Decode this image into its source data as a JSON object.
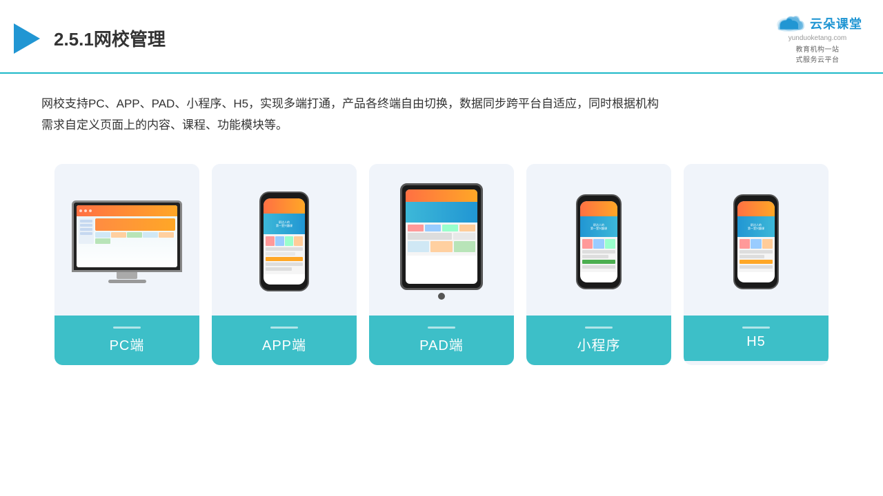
{
  "header": {
    "title": "2.5.1网校管理",
    "logo_main": "云朵课堂",
    "logo_url": "yunduoketang.com",
    "logo_subtitle": "教育机构一站\n式服务云平台"
  },
  "description": {
    "line1": "网校支持PC、APP、PAD、小程序、H5，实现多端打通，产品各终端自由切换，数据同步跨平台自适应，同时根据机构",
    "line2": "需求自定义页面上的内容、课程、功能模块等。"
  },
  "cards": [
    {
      "id": "pc",
      "label": "PC端"
    },
    {
      "id": "app",
      "label": "APP端"
    },
    {
      "id": "pad",
      "label": "PAD端"
    },
    {
      "id": "miniprogram",
      "label": "小程序"
    },
    {
      "id": "h5",
      "label": "H5"
    }
  ],
  "colors": {
    "accent": "#3dbfc8",
    "header_line": "#1cb8c8",
    "card_bg": "#f0f4fa",
    "logo_blue": "#2196d3"
  }
}
